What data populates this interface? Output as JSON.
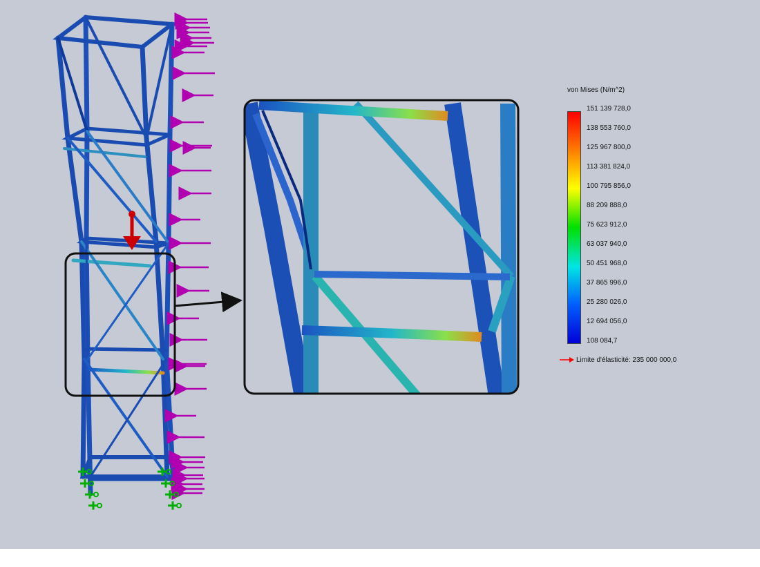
{
  "legend": {
    "title": "von Mises (N/m^2)",
    "ticks": [
      "151 139 728,0",
      "138 553 760,0",
      "125 967 800,0",
      "113 381 824,0",
      "100 795 856,0",
      "88 209 888,0",
      "75 623 912,0",
      "63 037 940,0",
      "50 451 968,0",
      "37 865 996,0",
      "25 280 026,0",
      "12 694 056,0",
      "108 084,7"
    ],
    "yield_label": "Limite d'élasticité: 235 000 000,0",
    "scale_colors": [
      "#ff0000",
      "#ff8000",
      "#ffff00",
      "#00e000",
      "#00e5e5",
      "#0060ff",
      "#0000d8"
    ]
  },
  "colors": {
    "background": "#c5cad5",
    "structure": "#1a4bb0",
    "load_arrows": "#b000b0",
    "force_arrow": "#cc0000",
    "fixtures": "#00b000",
    "yield_marker": "#ff0000"
  },
  "icons": [
    "distributed-load-arrows",
    "force-arrow-icon",
    "fixture-icons",
    "zoom-callout-arrow"
  ]
}
